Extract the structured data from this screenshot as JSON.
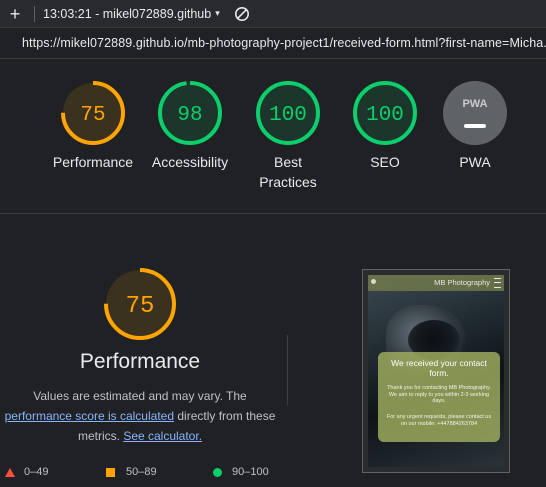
{
  "toolbar": {
    "plus_glyph": "+",
    "title": "13:03:21 - mikel072889.github",
    "caret_glyph": "▾"
  },
  "urlbar": {
    "url": "https://mikel072889.github.io/mb-photography-project1/received-form.html?first-name=Micha..."
  },
  "colors": {
    "pass": "#0cce6b",
    "average": "#ffa400",
    "fail": "#ff4e42",
    "pwa_gray": "#5f6368"
  },
  "gauges": [
    {
      "score": "75",
      "value": 75,
      "label": "Performance",
      "status": "average"
    },
    {
      "score": "98",
      "value": 98,
      "label": "Accessibility",
      "status": "pass"
    },
    {
      "score": "100",
      "value": 100,
      "label": "Best Practices",
      "status": "pass"
    },
    {
      "score": "100",
      "value": 100,
      "label": "SEO",
      "status": "pass"
    },
    {
      "score": "PWA",
      "label": "PWA",
      "status": "pwa",
      "icon": "pwa-icon"
    }
  ],
  "performance": {
    "score": "75",
    "value": 75,
    "title": "Performance",
    "note_prefix": "Values are estimated and may vary. The",
    "note_link": "performance score is calculated",
    "note_middle": "directly from these metrics.",
    "calc_link": "See calculator."
  },
  "legend": {
    "fail_range": "0–49",
    "average_range": "50–89",
    "pass_range": "90–100"
  },
  "preview": {
    "brand": "MB Photography",
    "card_title": "We received your contact form.",
    "card_text": "Thank you for contacting MB Photography. We aim to reply to you within 2-3 working days.",
    "card_text2": "For any urgent requests, please contact us on our mobile: +447884263784"
  }
}
